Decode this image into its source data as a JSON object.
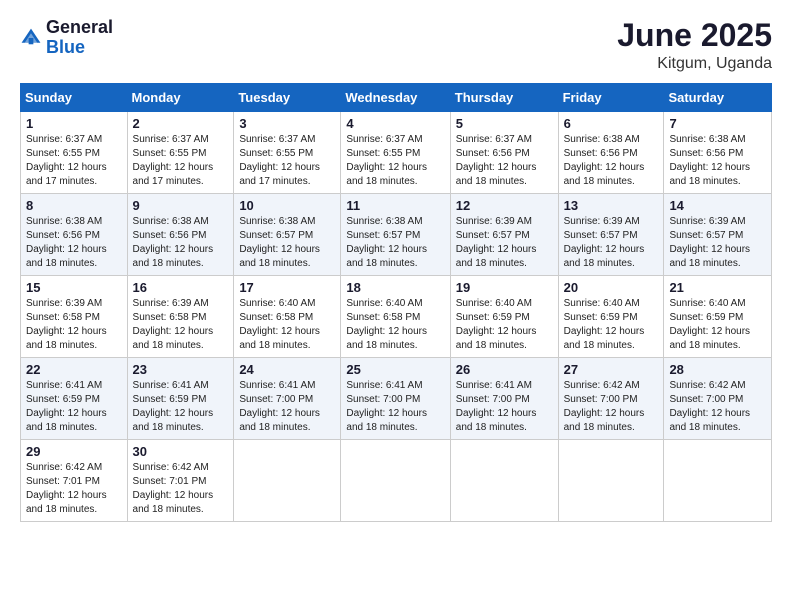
{
  "logo": {
    "general": "General",
    "blue": "Blue"
  },
  "title": {
    "month_year": "June 2025",
    "location": "Kitgum, Uganda"
  },
  "days_of_week": [
    "Sunday",
    "Monday",
    "Tuesday",
    "Wednesday",
    "Thursday",
    "Friday",
    "Saturday"
  ],
  "weeks": [
    [
      {
        "day": 1,
        "sunrise": "6:37 AM",
        "sunset": "6:55 PM",
        "daylight": "12 hours and 17 minutes."
      },
      {
        "day": 2,
        "sunrise": "6:37 AM",
        "sunset": "6:55 PM",
        "daylight": "12 hours and 17 minutes."
      },
      {
        "day": 3,
        "sunrise": "6:37 AM",
        "sunset": "6:55 PM",
        "daylight": "12 hours and 17 minutes."
      },
      {
        "day": 4,
        "sunrise": "6:37 AM",
        "sunset": "6:55 PM",
        "daylight": "12 hours and 18 minutes."
      },
      {
        "day": 5,
        "sunrise": "6:37 AM",
        "sunset": "6:56 PM",
        "daylight": "12 hours and 18 minutes."
      },
      {
        "day": 6,
        "sunrise": "6:38 AM",
        "sunset": "6:56 PM",
        "daylight": "12 hours and 18 minutes."
      },
      {
        "day": 7,
        "sunrise": "6:38 AM",
        "sunset": "6:56 PM",
        "daylight": "12 hours and 18 minutes."
      }
    ],
    [
      {
        "day": 8,
        "sunrise": "6:38 AM",
        "sunset": "6:56 PM",
        "daylight": "12 hours and 18 minutes."
      },
      {
        "day": 9,
        "sunrise": "6:38 AM",
        "sunset": "6:56 PM",
        "daylight": "12 hours and 18 minutes."
      },
      {
        "day": 10,
        "sunrise": "6:38 AM",
        "sunset": "6:57 PM",
        "daylight": "12 hours and 18 minutes."
      },
      {
        "day": 11,
        "sunrise": "6:38 AM",
        "sunset": "6:57 PM",
        "daylight": "12 hours and 18 minutes."
      },
      {
        "day": 12,
        "sunrise": "6:39 AM",
        "sunset": "6:57 PM",
        "daylight": "12 hours and 18 minutes."
      },
      {
        "day": 13,
        "sunrise": "6:39 AM",
        "sunset": "6:57 PM",
        "daylight": "12 hours and 18 minutes."
      },
      {
        "day": 14,
        "sunrise": "6:39 AM",
        "sunset": "6:57 PM",
        "daylight": "12 hours and 18 minutes."
      }
    ],
    [
      {
        "day": 15,
        "sunrise": "6:39 AM",
        "sunset": "6:58 PM",
        "daylight": "12 hours and 18 minutes."
      },
      {
        "day": 16,
        "sunrise": "6:39 AM",
        "sunset": "6:58 PM",
        "daylight": "12 hours and 18 minutes."
      },
      {
        "day": 17,
        "sunrise": "6:40 AM",
        "sunset": "6:58 PM",
        "daylight": "12 hours and 18 minutes."
      },
      {
        "day": 18,
        "sunrise": "6:40 AM",
        "sunset": "6:58 PM",
        "daylight": "12 hours and 18 minutes."
      },
      {
        "day": 19,
        "sunrise": "6:40 AM",
        "sunset": "6:59 PM",
        "daylight": "12 hours and 18 minutes."
      },
      {
        "day": 20,
        "sunrise": "6:40 AM",
        "sunset": "6:59 PM",
        "daylight": "12 hours and 18 minutes."
      },
      {
        "day": 21,
        "sunrise": "6:40 AM",
        "sunset": "6:59 PM",
        "daylight": "12 hours and 18 minutes."
      }
    ],
    [
      {
        "day": 22,
        "sunrise": "6:41 AM",
        "sunset": "6:59 PM",
        "daylight": "12 hours and 18 minutes."
      },
      {
        "day": 23,
        "sunrise": "6:41 AM",
        "sunset": "6:59 PM",
        "daylight": "12 hours and 18 minutes."
      },
      {
        "day": 24,
        "sunrise": "6:41 AM",
        "sunset": "7:00 PM",
        "daylight": "12 hours and 18 minutes."
      },
      {
        "day": 25,
        "sunrise": "6:41 AM",
        "sunset": "7:00 PM",
        "daylight": "12 hours and 18 minutes."
      },
      {
        "day": 26,
        "sunrise": "6:41 AM",
        "sunset": "7:00 PM",
        "daylight": "12 hours and 18 minutes."
      },
      {
        "day": 27,
        "sunrise": "6:42 AM",
        "sunset": "7:00 PM",
        "daylight": "12 hours and 18 minutes."
      },
      {
        "day": 28,
        "sunrise": "6:42 AM",
        "sunset": "7:00 PM",
        "daylight": "12 hours and 18 minutes."
      }
    ],
    [
      {
        "day": 29,
        "sunrise": "6:42 AM",
        "sunset": "7:01 PM",
        "daylight": "12 hours and 18 minutes."
      },
      {
        "day": 30,
        "sunrise": "6:42 AM",
        "sunset": "7:01 PM",
        "daylight": "12 hours and 18 minutes."
      },
      null,
      null,
      null,
      null,
      null
    ]
  ],
  "labels": {
    "sunrise": "Sunrise:",
    "sunset": "Sunset:",
    "daylight": "Daylight:"
  }
}
